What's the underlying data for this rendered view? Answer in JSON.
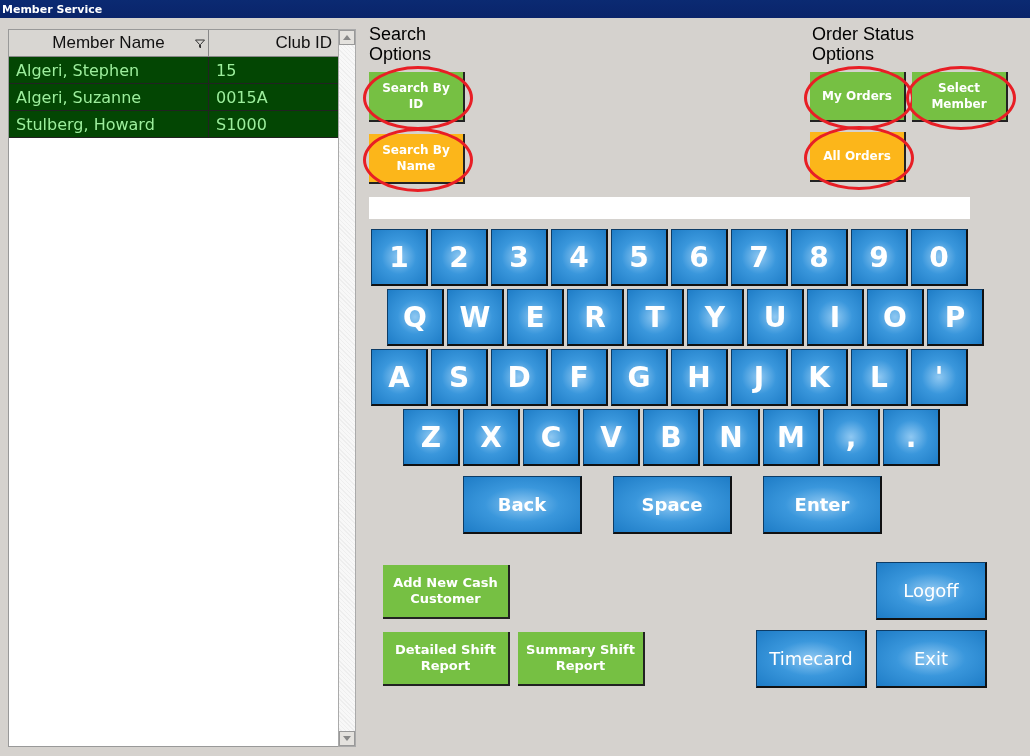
{
  "window": {
    "title": "Member Service"
  },
  "table": {
    "columns": [
      {
        "label": "Member Name",
        "filter": true
      },
      {
        "label": "Club ID",
        "filter": false
      }
    ],
    "rows": [
      {
        "cells": [
          "Algeri, Stephen",
          "15"
        ],
        "selected": true
      },
      {
        "cells": [
          "Algeri, Suzanne",
          "0015A"
        ],
        "selected": true
      },
      {
        "cells": [
          "Stulberg, Howard",
          "S1000"
        ],
        "selected": true
      }
    ]
  },
  "search_options": {
    "title": "Search Options",
    "buttons": [
      {
        "label": "Search By ID",
        "selected": false,
        "circled": true
      },
      {
        "label": "Search By Name",
        "selected": true,
        "circled": true
      }
    ]
  },
  "order_status_options": {
    "title": "Order Status Options",
    "buttons": [
      {
        "label": "My Orders",
        "selected": false,
        "circled": true
      },
      {
        "label": "Select Member",
        "selected": false,
        "circled": true
      },
      {
        "label": "All Orders",
        "selected": true,
        "circled": true
      }
    ]
  },
  "keyboard": {
    "rows": [
      [
        "1",
        "2",
        "3",
        "4",
        "5",
        "6",
        "7",
        "8",
        "9",
        "0"
      ],
      [
        "Q",
        "W",
        "E",
        "R",
        "T",
        "Y",
        "U",
        "I",
        "O",
        "P"
      ],
      [
        "A",
        "S",
        "D",
        "F",
        "G",
        "H",
        "J",
        "K",
        "L",
        "'"
      ],
      [
        "Z",
        "X",
        "C",
        "V",
        "B",
        "N",
        "M",
        ",",
        "."
      ]
    ],
    "actions": [
      "Back",
      "Space",
      "Enter"
    ]
  },
  "report_buttons": [
    "Add New Cash Customer",
    "Detailed Shift Report",
    "Summary Shift Report"
  ],
  "system_buttons": [
    "Logoff",
    "Timecard",
    "Exit"
  ]
}
